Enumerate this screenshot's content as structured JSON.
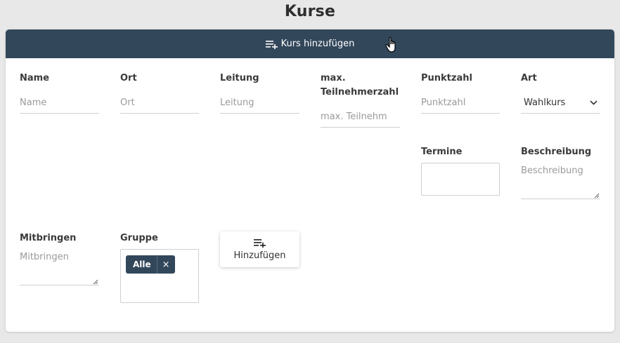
{
  "page": {
    "title": "Kurse"
  },
  "header": {
    "add_label": "Kurs hinzufügen",
    "icon": "playlist-add-icon"
  },
  "fields": {
    "name": {
      "label": "Name",
      "placeholder": "Name"
    },
    "ort": {
      "label": "Ort",
      "placeholder": "Ort"
    },
    "leitung": {
      "label": "Leitung",
      "placeholder": "Leitung"
    },
    "max_teilnehmer": {
      "label_line1": "max.",
      "label_line2": "Teilnehmerzahl",
      "placeholder": "max. Teilnehm"
    },
    "punktzahl": {
      "label": "Punktzahl",
      "placeholder": "Punktzahl"
    },
    "art": {
      "label": "Art",
      "value": "Wahlkurs"
    },
    "termine": {
      "label": "Termine"
    },
    "beschreibung": {
      "label": "Beschreibung",
      "placeholder": "Beschreibung"
    },
    "mitbringen": {
      "label": "Mitbringen",
      "placeholder": "Mitbringen"
    },
    "gruppe": {
      "label": "Gruppe",
      "chips": [
        {
          "label": "Alle",
          "remove": "×"
        }
      ]
    }
  },
  "add_button": {
    "label": "Hinzufügen",
    "icon": "playlist-add-icon"
  },
  "colors": {
    "header_bg": "#33475b",
    "page_bg": "#e8e8e8",
    "card_bg": "#ffffff"
  }
}
